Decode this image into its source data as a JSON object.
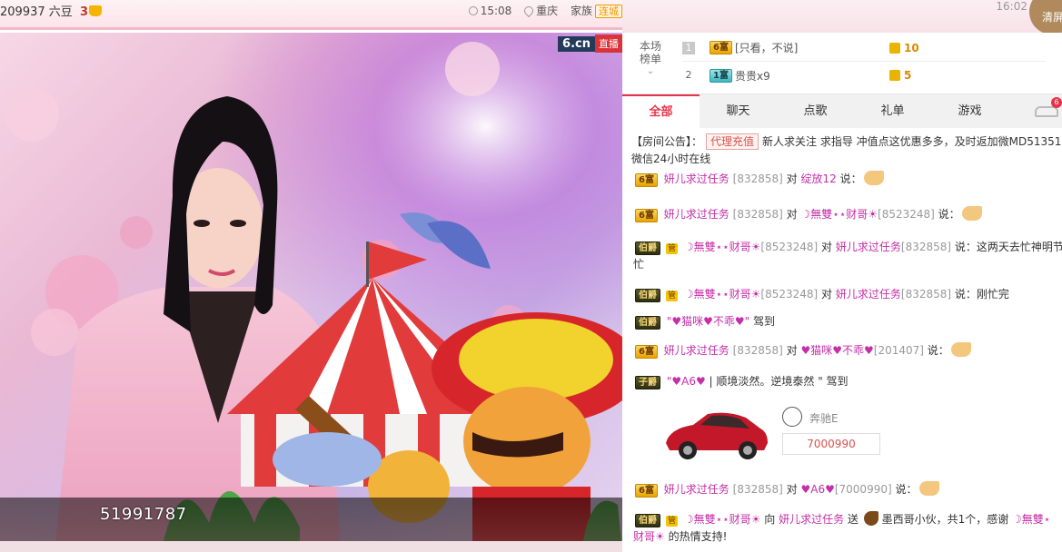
{
  "header": {
    "room_id": "209937",
    "room_name": "六豆",
    "room_level": "3",
    "time": "15:08",
    "city": "重庆",
    "family_label": "家族",
    "family_badge": "连城"
  },
  "video": {
    "logo": "6.cn",
    "live_label": "直播",
    "overlay_number": "51991787"
  },
  "panel": {
    "time": "16:02",
    "clear_label": "清屏",
    "rank_title_line1": "本场",
    "rank_title_line2": "榜单",
    "ranking": [
      {
        "rank": "1",
        "level": "6富",
        "name": "[只看，不说]",
        "score": "10"
      },
      {
        "rank": "2",
        "level": "1富",
        "name": "贵贵x9",
        "score": "5"
      }
    ],
    "tabs": [
      {
        "label": "全部",
        "active": true
      },
      {
        "label": "聊天",
        "active": false
      },
      {
        "label": "点歌",
        "active": false
      },
      {
        "label": "礼单",
        "active": false
      },
      {
        "label": "游戏",
        "active": false
      }
    ],
    "car_count": "6"
  },
  "chat": {
    "notice_prefix": "【房间公告】：",
    "notice_tag": "代理充值",
    "notice_text": "新人求关注 求指导 冲值点这优惠多多，及时返加微MD51351",
    "notice_line2": "微信24小时在线",
    "messages": [
      {
        "level": "6富",
        "nick": "妍儿求过任务",
        "uid": "[832858]",
        "verb": "对",
        "target": "绽放12",
        "target_uid": "",
        "text": "说："
      },
      {
        "level": "6富",
        "nick": "妍儿求过任务",
        "uid": "[832858]",
        "verb": "对",
        "target": "☽無雙⋆⋆财哥☀",
        "target_uid": "[8523248]",
        "text": "说："
      },
      {
        "level": "伯爵",
        "mgr": "管",
        "nick": "☽無雙⋆⋆财哥☀",
        "uid": "[8523248]",
        "verb": "对",
        "target": "妍儿求过任务",
        "target_uid": "[832858]",
        "text": "说：这两天去忙神明节",
        "text2": "忙"
      },
      {
        "level": "伯爵",
        "mgr": "管",
        "nick": "☽無雙⋆⋆财哥☀",
        "uid": "[8523248]",
        "verb": "对",
        "target": "妍儿求过任务",
        "target_uid": "[832858]",
        "text": "说：刚忙完"
      },
      {
        "level": "伯爵",
        "nick": "\"♥猫咪♥不乖♥\"",
        "text": "驾到"
      },
      {
        "level": "6富",
        "nick": "妍儿求过任务",
        "uid": "[832858]",
        "verb": "对",
        "target": "♥猫咪♥不乖♥",
        "target_uid": "[201407]",
        "text": "说："
      },
      {
        "level": "子爵",
        "nick": "\"♥A6♥",
        "text": "| 顺境淡然。逆境泰然 \" 驾到"
      },
      {
        "level": "6富",
        "nick": "妍儿求过任务",
        "uid": "[832858]",
        "verb": "对",
        "target": "♥A6♥",
        "target_uid": "[7000990]",
        "text": "说："
      },
      {
        "level": "伯爵",
        "mgr": "管",
        "nick": "☽無雙⋆⋆财哥☀",
        "verb": "向",
        "target": "妍儿求过任务",
        "text": "送",
        "gift": "墨西哥小伙，共1个，感谢",
        "thanks_to": "☽無雙⋆",
        "text2_nick": "财哥☀",
        "text2": "的热情支持!"
      }
    ],
    "car_card": {
      "name": "奔驰E",
      "id": "7000990"
    }
  }
}
